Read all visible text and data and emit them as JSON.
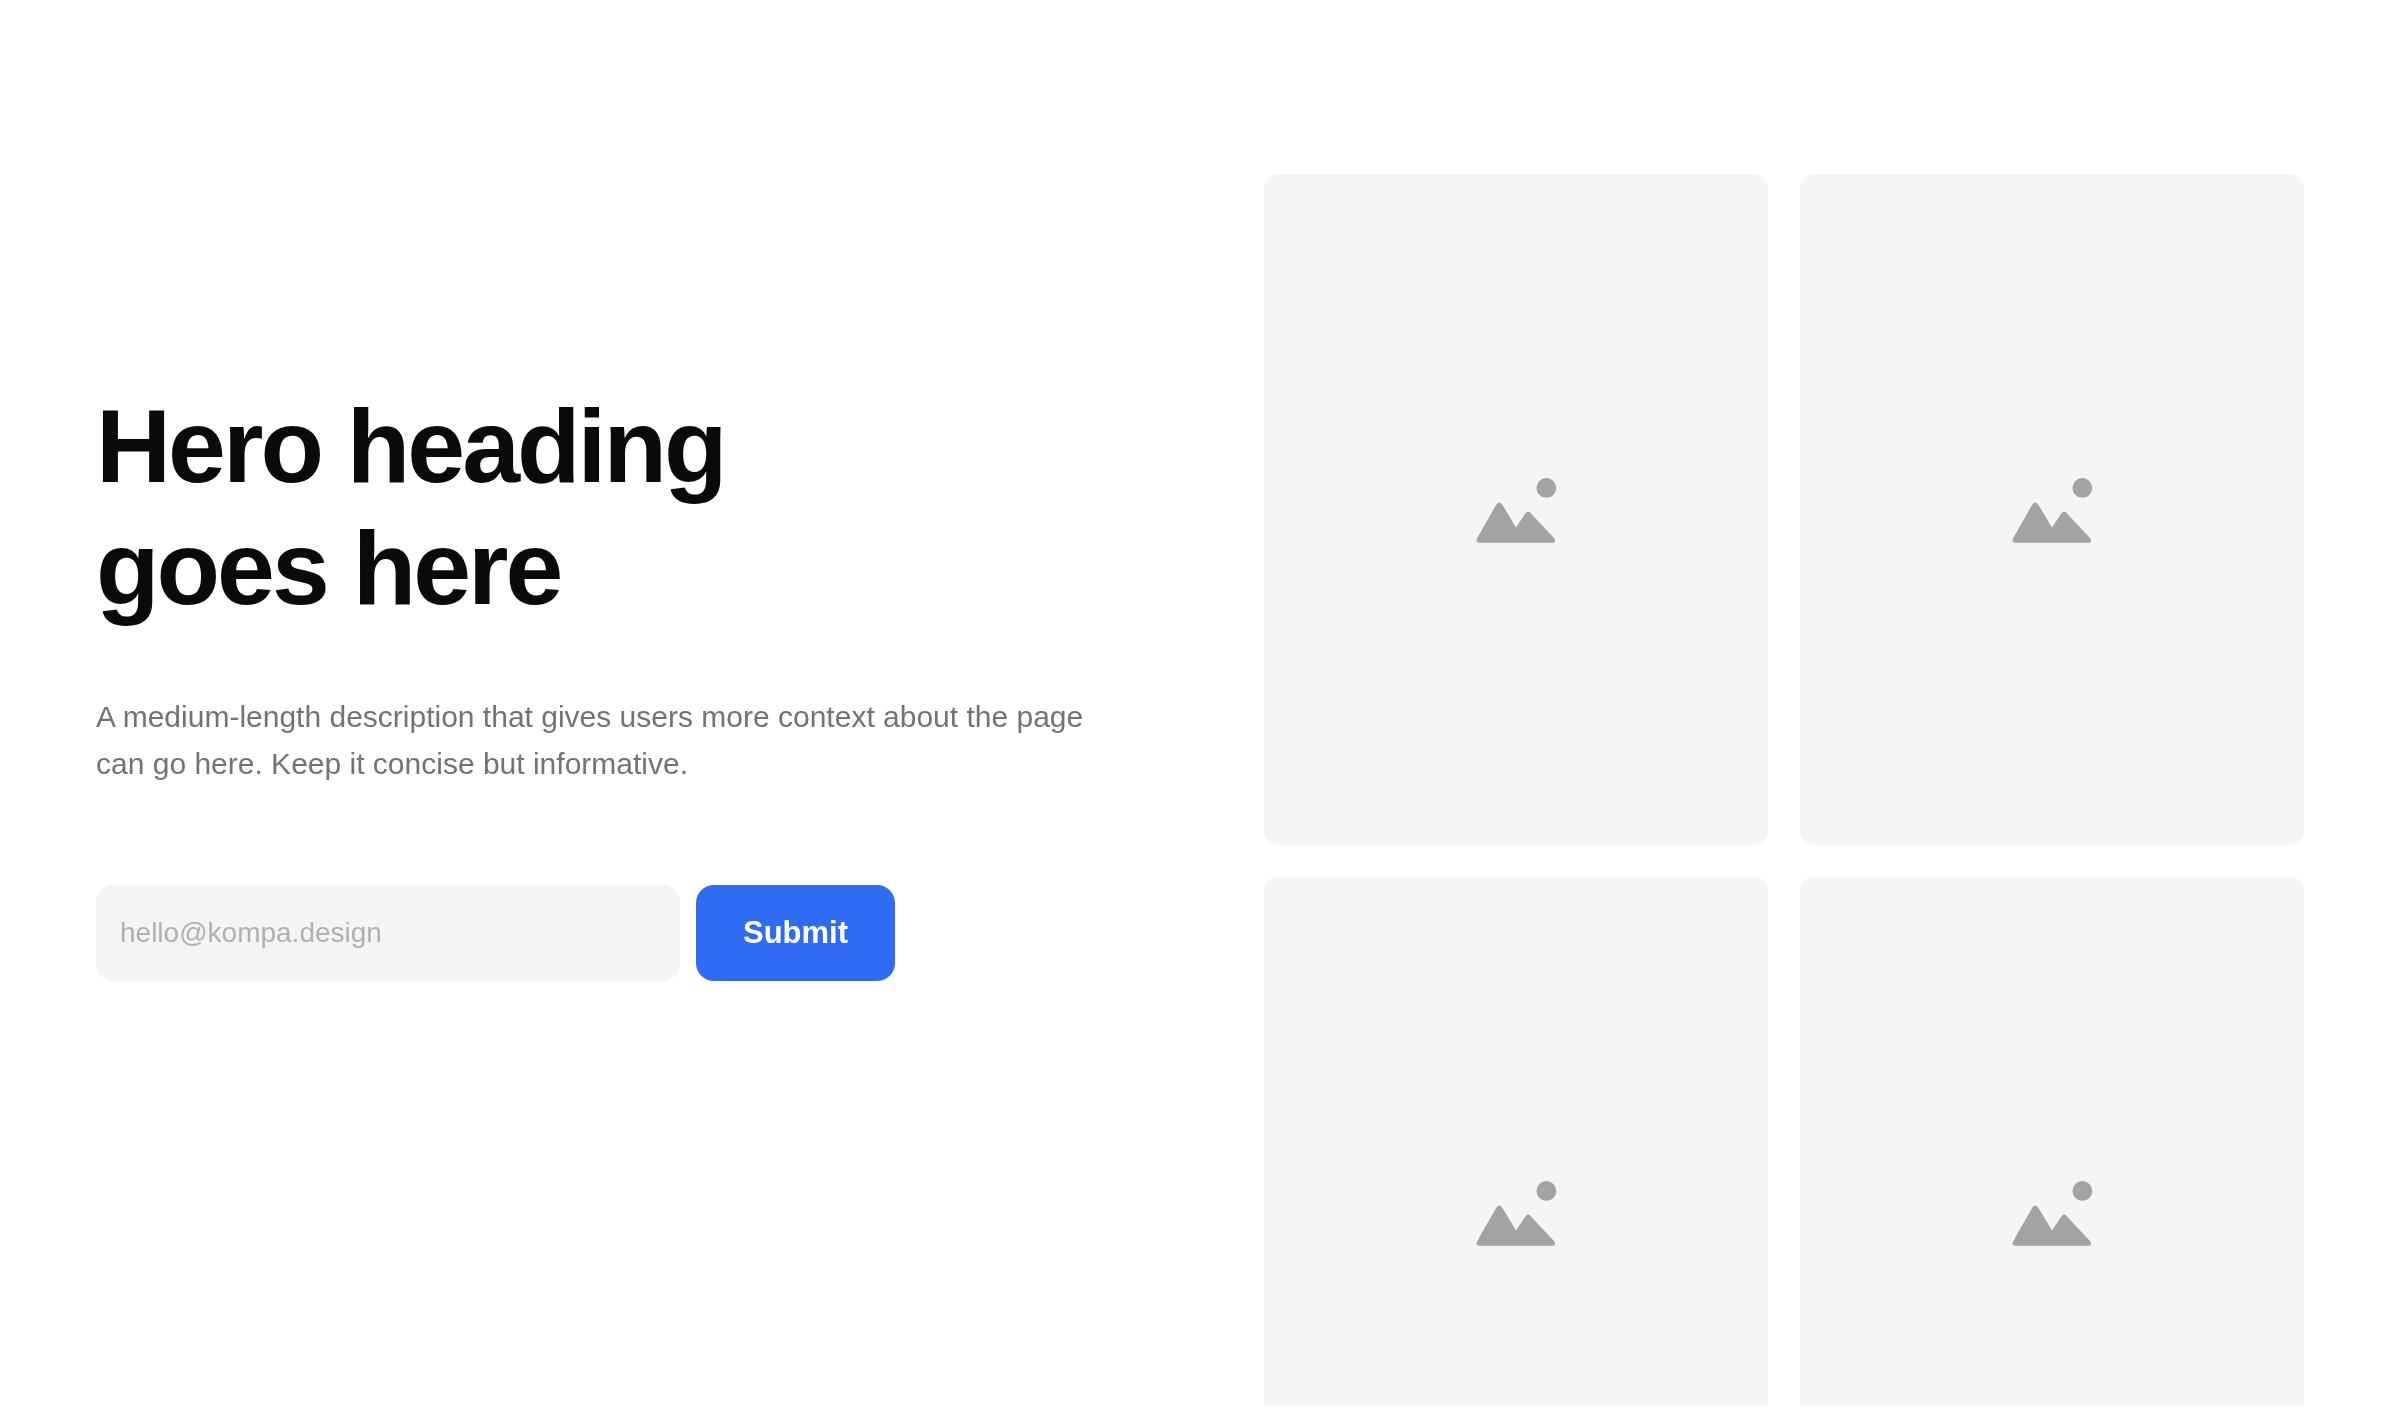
{
  "hero": {
    "heading": "Hero heading goes here",
    "description": "A medium-length description that gives users more context about the page can go here. Keep it concise but informative.",
    "email_field": {
      "placeholder": "hello@kompa.design"
    },
    "submit_button": "Submit"
  },
  "images": [
    {
      "kind": "placeholder"
    },
    {
      "kind": "placeholder"
    },
    {
      "kind": "placeholder"
    },
    {
      "kind": "placeholder"
    }
  ]
}
